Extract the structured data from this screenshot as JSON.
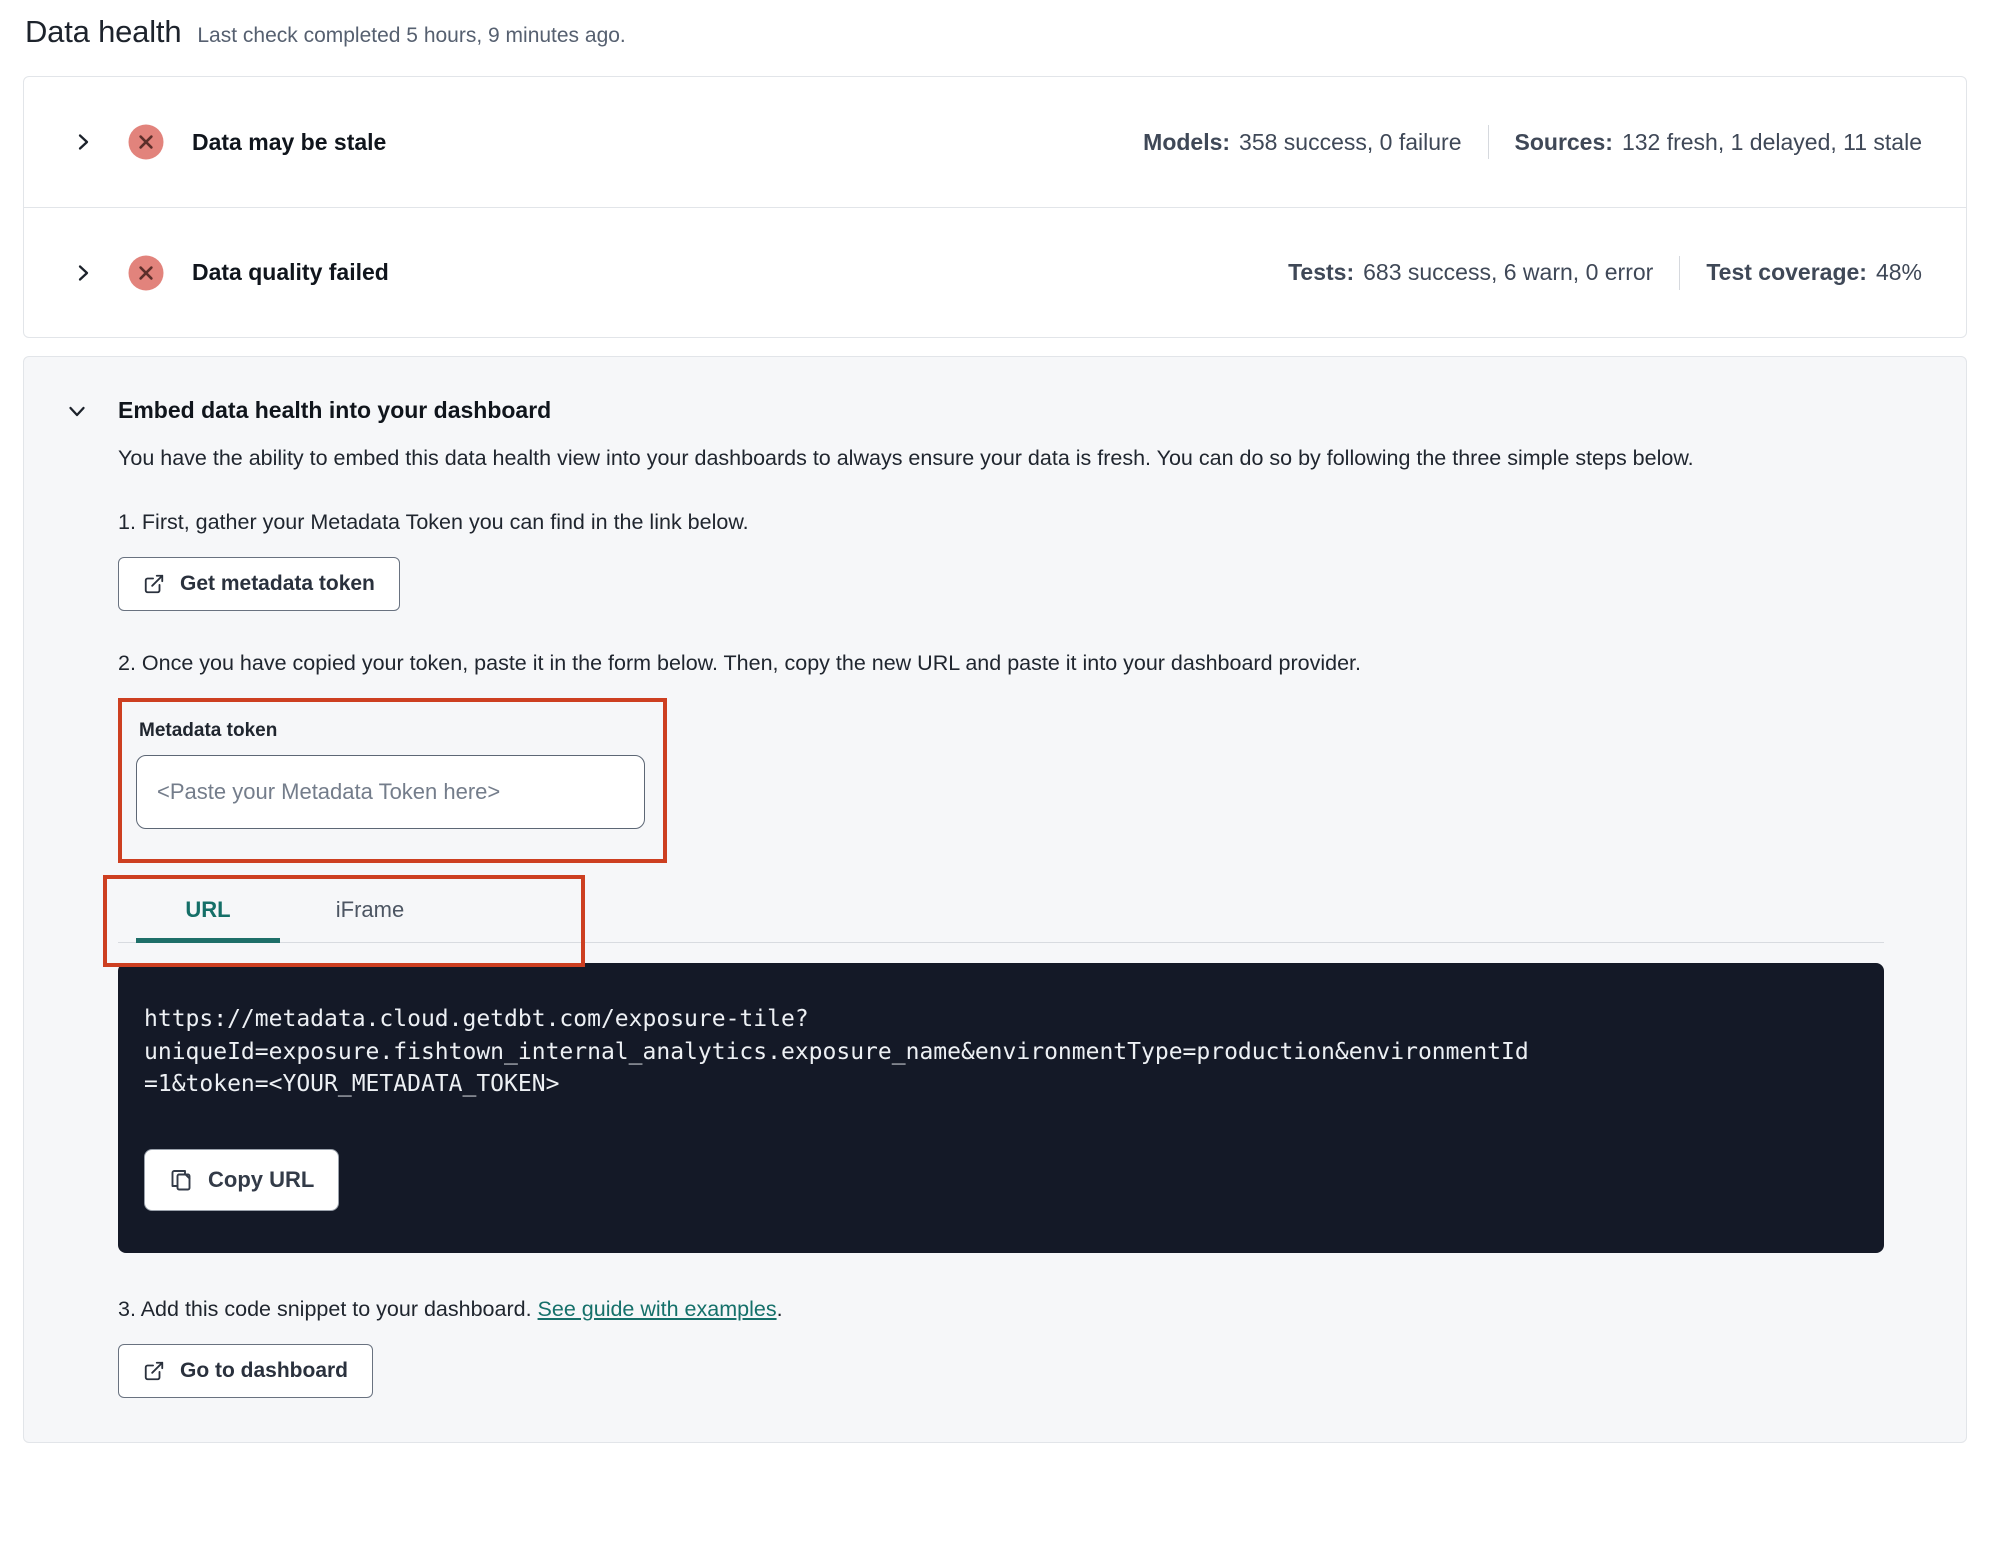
{
  "header": {
    "title": "Data health",
    "subtitle": "Last check completed 5 hours, 9 minutes ago."
  },
  "status_rows": [
    {
      "title": "Data may be stale",
      "status": "error",
      "stats": [
        {
          "label": "Models:",
          "value": "358 success, 0 failure"
        },
        {
          "label": "Sources:",
          "value": "132 fresh, 1 delayed, 11 stale"
        }
      ]
    },
    {
      "title": "Data quality failed",
      "status": "error",
      "stats": [
        {
          "label": "Tests:",
          "value": "683 success, 6 warn, 0 error"
        },
        {
          "label": "Test coverage:",
          "value": "48%"
        }
      ]
    }
  ],
  "embed": {
    "title": "Embed data health into your dashboard",
    "description": "You have the ability to embed this data health view into your dashboards to always ensure your data is fresh. You can do so by following the three simple steps below.",
    "step1": {
      "text": "1. First, gather your Metadata Token you can find in the link below.",
      "button": "Get metadata token"
    },
    "step2": {
      "text": "2. Once you have copied your token, paste it in the form below. Then, copy the new URL and paste it into your dashboard provider.",
      "token_label": "Metadata token",
      "token_placeholder": "<Paste your Metadata Token here>",
      "tabs": [
        {
          "label": "URL",
          "active": true
        },
        {
          "label": "iFrame",
          "active": false
        }
      ],
      "code_url": "https://metadata.cloud.getdbt.com/exposure-tile?uniqueId=exposure.fishtown_internal_analytics.exposure_name&environmentType=production&environmentId=1&token=<YOUR_METADATA_TOKEN>",
      "code_lines": [
        "https://metadata.cloud.getdbt.com/exposure-tile?",
        "uniqueId=exposure.fishtown_internal_analytics.exposure_name&environmentType=production&environmentId",
        "=1&token=<YOUR_METADATA_TOKEN>"
      ],
      "copy_button": "Copy URL"
    },
    "step3": {
      "text_before_link": "3. Add this code snippet to your dashboard. ",
      "link": "See guide with examples",
      "text_after_link": ".",
      "button": "Go to dashboard"
    }
  },
  "colors": {
    "accent_teal": "#15706a",
    "error_badge": "#e2837c",
    "annotation_red": "#cd3f21",
    "code_background": "#141927"
  }
}
